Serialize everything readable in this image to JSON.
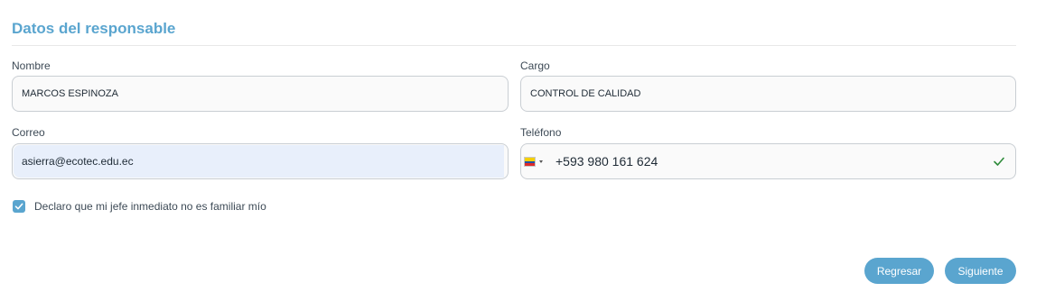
{
  "section": {
    "title": "Datos del responsable"
  },
  "fields": {
    "nombre": {
      "label": "Nombre",
      "value": "MARCOS ESPINOZA"
    },
    "cargo": {
      "label": "Cargo",
      "value": "CONTROL DE CALIDAD"
    },
    "correo": {
      "label": "Correo",
      "value": "asierra@ecotec.edu.ec"
    },
    "telefono": {
      "label": "Teléfono",
      "value": "+593 980 161 624",
      "country_flag": "ecuador-flag-icon",
      "valid": true
    }
  },
  "declaration": {
    "checked": true,
    "label": "Declaro que mi jefe inmediato no es familiar mío"
  },
  "buttons": {
    "back": "Regresar",
    "next": "Siguiente"
  },
  "colors": {
    "accent": "#5aa5cf",
    "valid_check": "#2e8b3a",
    "autofill_bg": "#e8effb"
  }
}
